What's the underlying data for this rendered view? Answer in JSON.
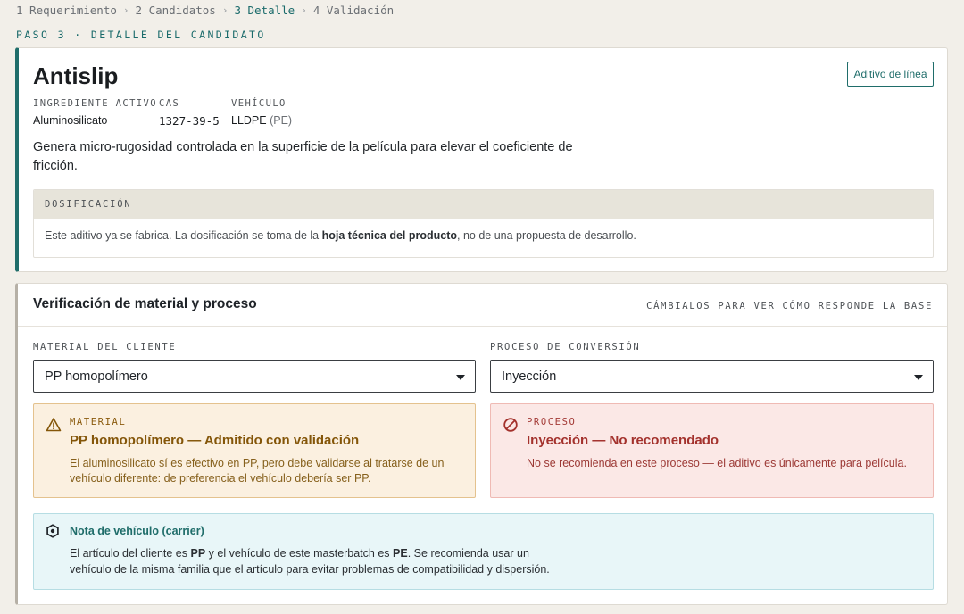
{
  "stepper": {
    "steps": [
      {
        "label": "1 Requerimiento",
        "active": false
      },
      {
        "label": "2 Candidatos",
        "active": false
      },
      {
        "label": "3 Detalle",
        "active": true
      },
      {
        "label": "4 Validación",
        "active": false
      }
    ],
    "separator": "›"
  },
  "step_label": "PASO 3 · DETALLE DEL CANDIDATO",
  "candidate": {
    "name": "Antislip",
    "badge": "Aditivo de línea",
    "fields": {
      "ingredient_label": "INGREDIENTE ACTIVO",
      "ingredient_value": "Aluminosilicato",
      "cas_label": "CAS",
      "cas_value": "1327-39-5",
      "vehicle_label": "VEHÍCULO",
      "vehicle_value": "LLDPE",
      "vehicle_family": "(PE)"
    },
    "description": "Genera micro-rugosidad controlada en la superficie de la película para elevar el coeficiente de fricción.",
    "dosage": {
      "heading": "DOSIFICACIÓN",
      "text_before": "Este aditivo ya se fabrica. La dosificación se toma de la",
      "text_bold": "hoja técnica del producto",
      "text_after": ", no de una propuesta de desarrollo."
    }
  },
  "verification": {
    "title": "Verificación de material y proceso",
    "hint": "CÁMBIALOS PARA VER CÓMO RESPONDE LA BASE",
    "material_label": "MATERIAL DEL CLIENTE",
    "material_value": "PP homopolímero",
    "process_label": "PROCESO DE CONVERSIÓN",
    "process_value": "Inyección",
    "material_alert": {
      "kicker": "MATERIAL",
      "headline": "PP homopolímero — Admitido con validación",
      "body": "El aluminosilicato sí es efectivo en PP, pero debe validarse al tratarse de un vehículo diferente: de preferencia el vehículo debería ser PP.",
      "icon": "warning-icon",
      "color": "#845609"
    },
    "process_alert": {
      "kicker": "PROCESO",
      "headline": "Inyección — No recomendado",
      "body": "No se recomienda en este proceso — el aditivo es únicamente para película.",
      "icon": "prohibited-icon",
      "color": "#a3312c"
    },
    "note": {
      "title": "Nota de vehículo (carrier)",
      "p1": "El artículo del cliente es",
      "b1": "PP",
      "p2": "y el vehículo de este masterbatch es",
      "b2": "PE",
      "p3": ". Se recomienda usar un vehículo de la misma familia que el artículo para evitar problemas de compatibilidad y dispersión.",
      "icon": "hexagon-dot-icon"
    }
  },
  "colors": {
    "accent": "#1f6d6a",
    "background": "#f2efe9"
  }
}
